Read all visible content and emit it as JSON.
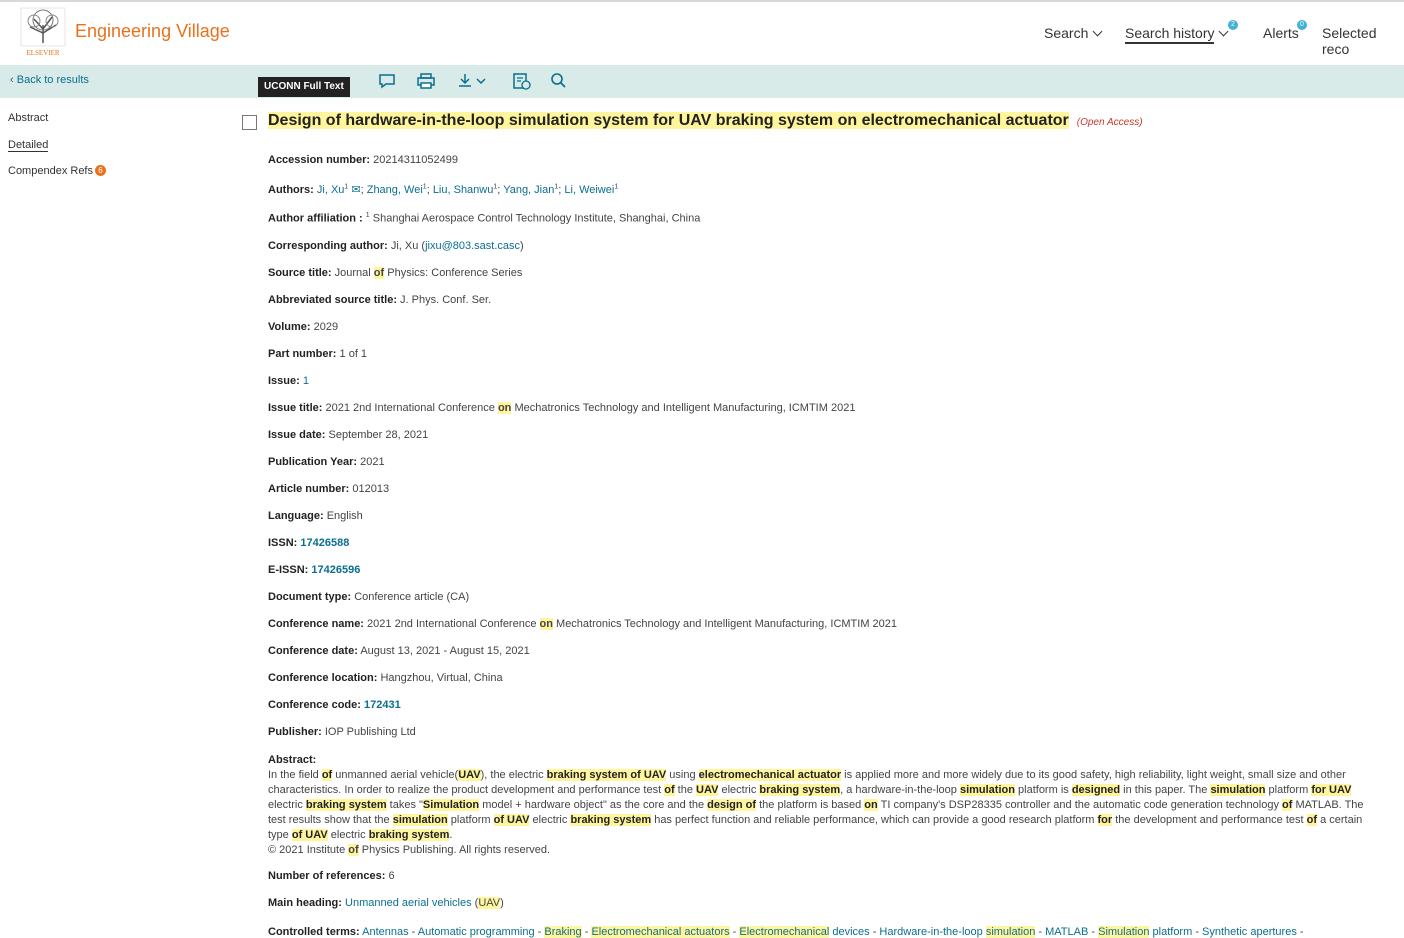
{
  "header": {
    "brand": "Engineering Village",
    "logo_text": "ELSEVIER",
    "nav": {
      "search": "Search",
      "search_history": "Search history",
      "search_history_badge": "2",
      "alerts": "Alerts",
      "alerts_badge": "0",
      "selected": "Selected reco"
    }
  },
  "toolbar": {
    "back": "Back to results",
    "full_text": "UCONN Full Text",
    "icons": [
      "comment-icon",
      "print-icon",
      "download-icon",
      "save-to-folder-icon",
      "search-icon"
    ]
  },
  "sidebar": {
    "abstract": "Abstract",
    "detailed": "Detailed",
    "compendex_refs": "Compendex Refs",
    "compendex_refs_badge": "6"
  },
  "record": {
    "title": "Design of hardware-in-the-loop simulation system for UAV braking system on electromechanical actuator",
    "open_access": "(Open Access)",
    "accession_label": "Accession number:",
    "accession": "20214311052499",
    "authors_label": "Authors:",
    "authors": [
      {
        "name": "Ji, Xu",
        "sup": "1"
      },
      {
        "name": "Zhang, Wei",
        "sup": "1"
      },
      {
        "name": "Liu, Shanwu",
        "sup": "1"
      },
      {
        "name": "Yang, Jian",
        "sup": "1"
      },
      {
        "name": "Li, Weiwei",
        "sup": "1"
      }
    ],
    "affiliation_label": "Author affiliation :",
    "affiliation_sup": "1",
    "affiliation": "Shanghai Aerospace Control Technology Institute, Shanghai, China",
    "corresponding_label": "Corresponding author:",
    "corresponding_name": "Ji, Xu (",
    "corresponding_email": "jixu@803.sast.casc",
    "corresponding_close": ")",
    "source_label": "Source title:",
    "source_a": "Journal",
    "source_of": "of",
    "source_b": "Physics: Conference Series",
    "abbrev_label": "Abbreviated source title:",
    "abbrev": "J. Phys. Conf. Ser.",
    "volume_label": "Volume:",
    "volume": "2029",
    "part_label": "Part number:",
    "part": "1 of 1",
    "issue_label": "Issue:",
    "issue": "1",
    "issue_title_label": "Issue title:",
    "issue_title_a": "2021 2nd International Conference",
    "issue_title_on": "on",
    "issue_title_b": "Mechatronics Technology and Intelligent Manufacturing, ICMTIM 2021",
    "issue_date_label": "Issue date:",
    "issue_date": "September 28, 2021",
    "pub_year_label": "Publication Year:",
    "pub_year": "2021",
    "article_label": "Article number:",
    "article": "012013",
    "language_label": "Language:",
    "language": "English",
    "issn_label": "ISSN:",
    "issn": "17426588",
    "eissn_label": "E-ISSN:",
    "eissn": "17426596",
    "doctype_label": "Document type:",
    "doctype": "Conference article (CA)",
    "conf_name_label": "Conference name:",
    "conf_name_a": "2021 2nd International Conference",
    "conf_name_on": "on",
    "conf_name_b": "Mechatronics Technology and Intelligent Manufacturing, ICMTIM 2021",
    "conf_date_label": "Conference date:",
    "conf_date": "August 13, 2021 - August 15, 2021",
    "conf_loc_label": "Conference location:",
    "conf_loc": "Hangzhou, Virtual, China",
    "conf_code_label": "Conference code:",
    "conf_code": "172431",
    "publisher_label": "Publisher:",
    "publisher": "IOP Publishing Ltd",
    "abstract_label": "Abstract:",
    "copyright_a": "© 2021 Institute",
    "copyright_of": "of",
    "copyright_b": "Physics Publishing. All rights reserved.",
    "refs_label": "Number of references:",
    "refs": "6",
    "main_heading_label": "Main heading:",
    "main_heading": "Unmanned aerial vehicles",
    "main_heading_uav": "UAV",
    "controlled_label": "Controlled terms:"
  }
}
